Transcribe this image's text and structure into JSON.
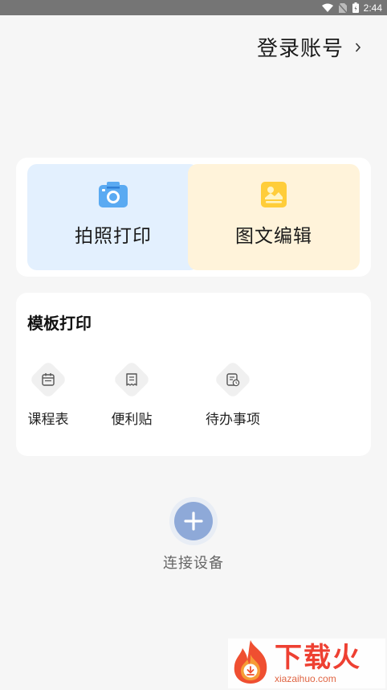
{
  "status_bar": {
    "time": "2:44",
    "icons": [
      "wifi-icon",
      "no-sim-icon",
      "battery-icon"
    ]
  },
  "header": {
    "login_label": "登录账号",
    "login_icon": "chevron-right-icon"
  },
  "actions": [
    {
      "label": "拍照打印",
      "icon": "camera-icon",
      "bg": "#e3f0fe",
      "icon_color": "#5aaaf2"
    },
    {
      "label": "图文编辑",
      "icon": "image-edit-icon",
      "bg": "#fff3da",
      "icon_color": "#ffcd3a"
    }
  ],
  "templates": {
    "title": "模板打印",
    "items": [
      {
        "label": "课程表",
        "icon": "calendar-icon"
      },
      {
        "label": "便利贴",
        "icon": "receipt-icon"
      },
      {
        "label": "待办事项",
        "icon": "todo-list-icon"
      }
    ]
  },
  "connect": {
    "label": "连接设备",
    "icon": "plus-icon",
    "color": "#8ea9d8"
  },
  "watermark": {
    "title": "下载火",
    "url": "xiazaihuo.com"
  }
}
